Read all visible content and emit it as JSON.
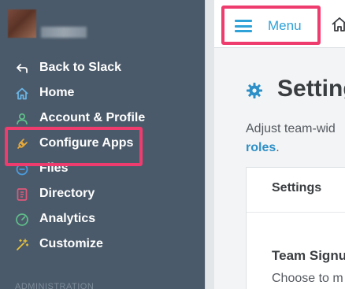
{
  "sidebar": {
    "items": [
      {
        "label": "Back to Slack",
        "icon": "back-arrow-icon"
      },
      {
        "label": "Home",
        "icon": "home-icon"
      },
      {
        "label": "Account & Profile",
        "icon": "person-icon"
      },
      {
        "label": "Configure Apps",
        "icon": "plug-icon"
      },
      {
        "label": "Files",
        "icon": "files-icon"
      },
      {
        "label": "Directory",
        "icon": "directory-icon"
      },
      {
        "label": "Analytics",
        "icon": "gauge-icon"
      },
      {
        "label": "Customize",
        "icon": "magic-wand-icon"
      }
    ],
    "section_label": "ADMINISTRATION"
  },
  "topbar": {
    "menu_label": "Menu"
  },
  "main": {
    "title": "Settings",
    "description_text": "Adjust team-wid",
    "description_link": "roles",
    "description_after_link": ".",
    "card": {
      "tab_label": "Settings",
      "heading": "Team Signu",
      "text": "Choose to m"
    }
  },
  "colors": {
    "sidebar_bg": "#4b5a6a",
    "highlight": "#ef3c6e",
    "accent": "#2fa2d8",
    "link": "#2d8fc7"
  }
}
